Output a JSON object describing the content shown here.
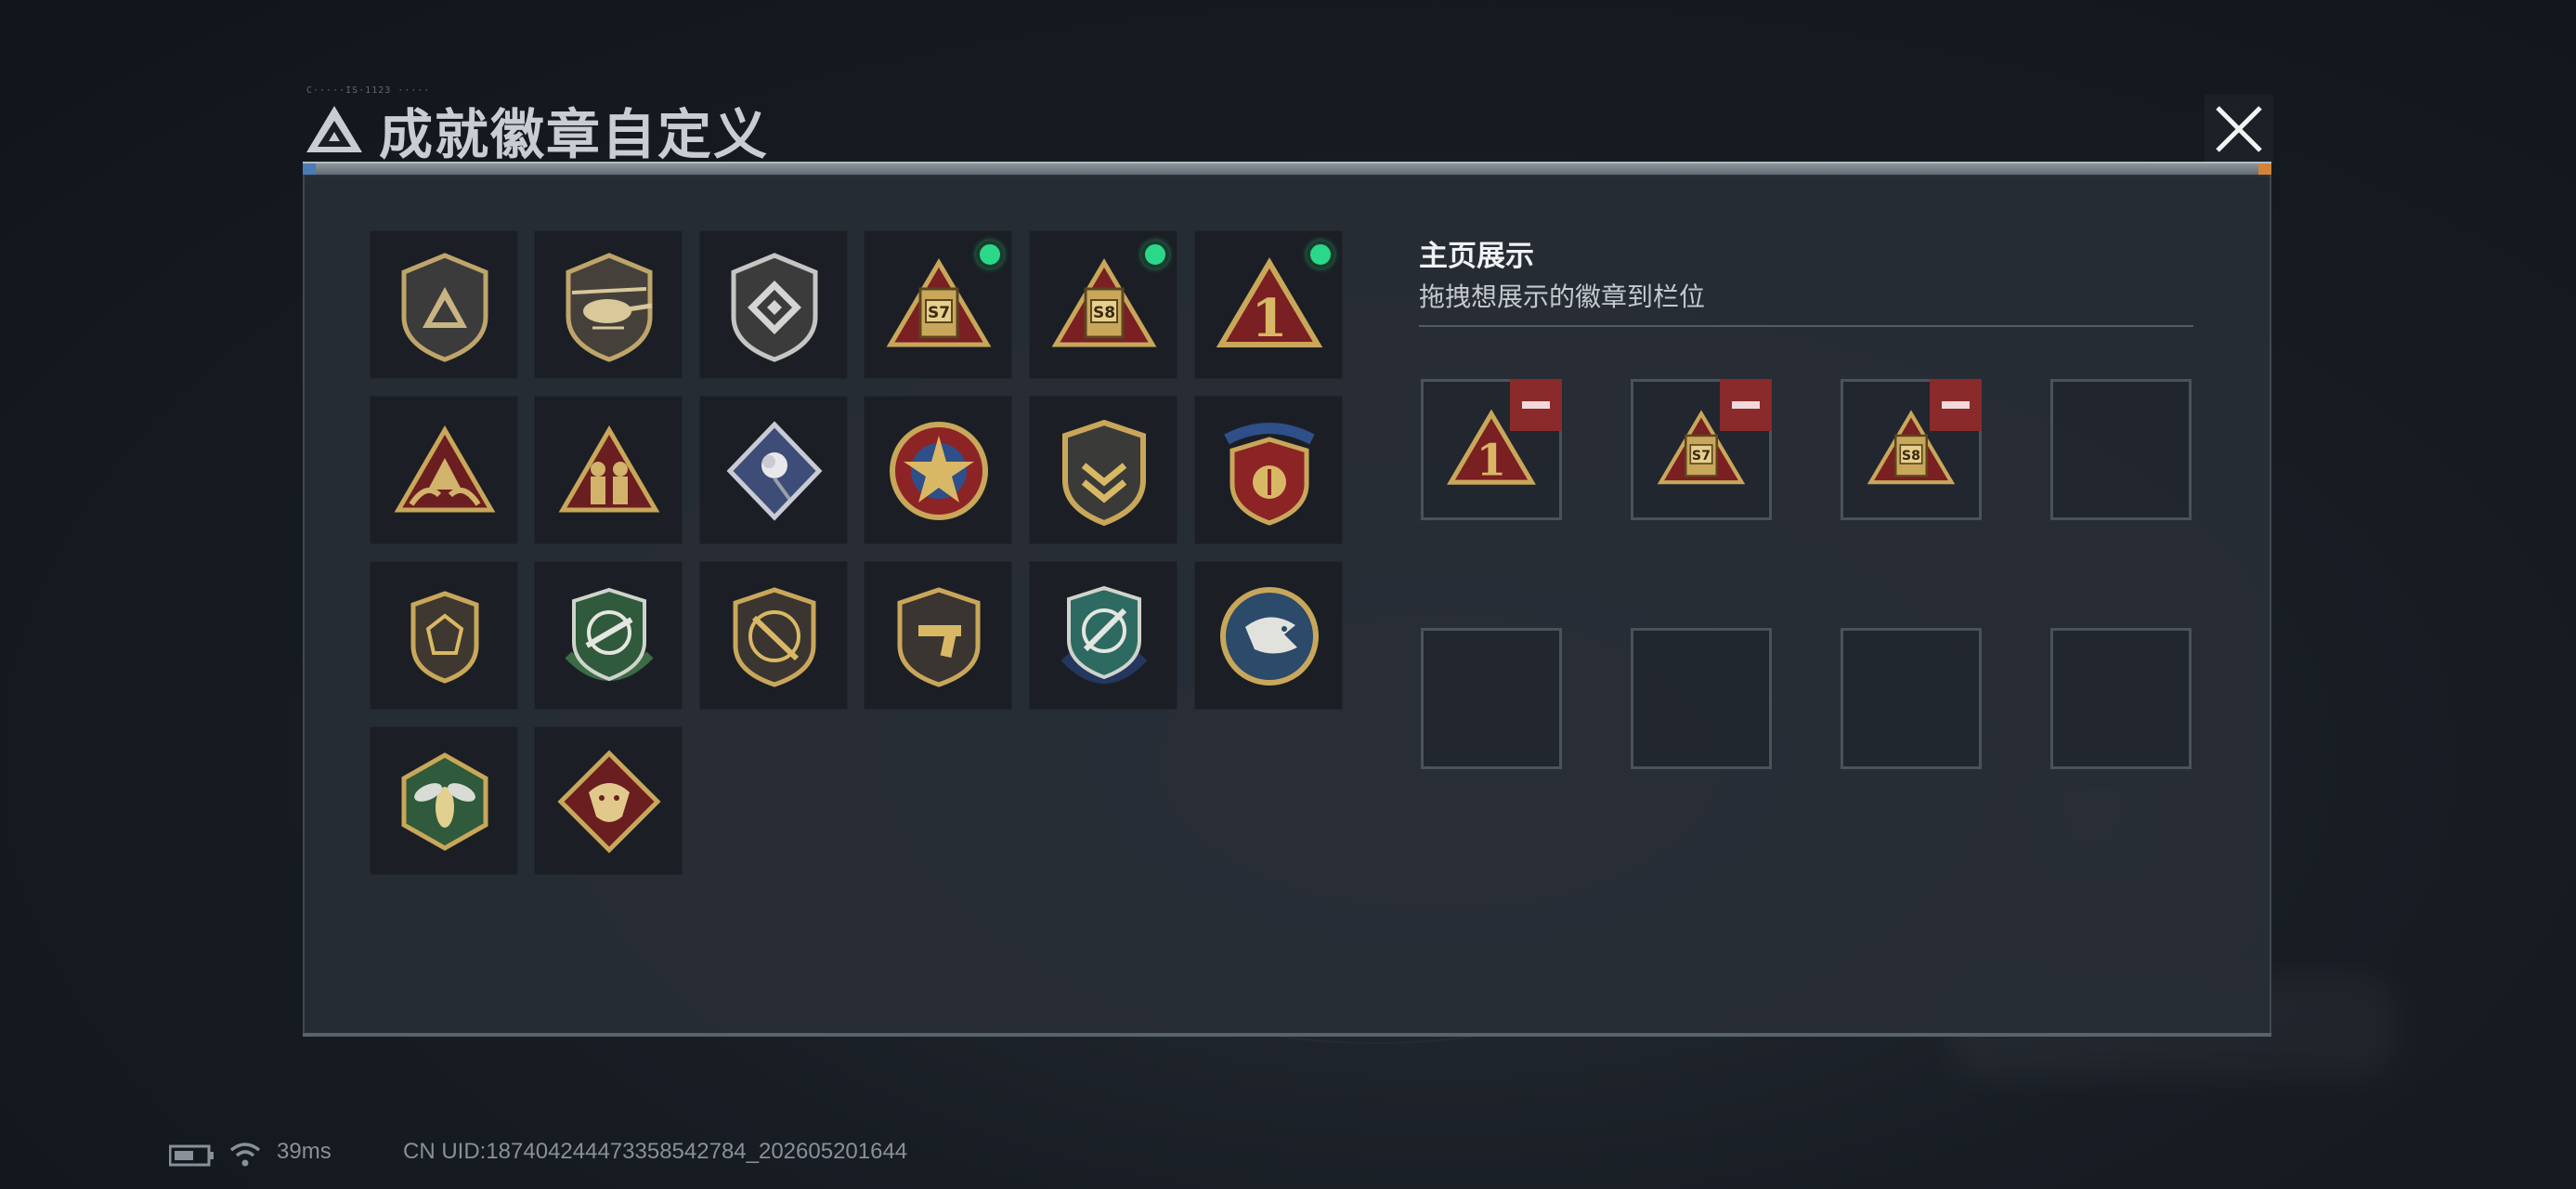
{
  "header": {
    "title": "成就徽章自定义",
    "deco_text": "C·····IS·1123 ·····"
  },
  "badges": [
    {
      "name": "triangle-logo-badge",
      "equipped": false
    },
    {
      "name": "helicopter-badge",
      "equipped": false
    },
    {
      "name": "diamond-emblem-badge",
      "equipped": false
    },
    {
      "name": "season-s7-badge",
      "text": "S7",
      "equipped": true
    },
    {
      "name": "season-s8-badge",
      "text": "S8",
      "equipped": true
    },
    {
      "name": "rank-one-badge",
      "text": "1",
      "equipped": true
    },
    {
      "name": "hands-triangle-badge",
      "equipped": false
    },
    {
      "name": "soldiers-triangle-badge",
      "equipped": false
    },
    {
      "name": "rose-diamond-badge",
      "equipped": false
    },
    {
      "name": "star-medal-badge",
      "equipped": false
    },
    {
      "name": "chevron-shield-badge",
      "equipped": false
    },
    {
      "name": "stars-shield-badge",
      "equipped": false
    },
    {
      "name": "gem-shield-badge",
      "equipped": false
    },
    {
      "name": "rifle-crosshair-badge",
      "equipped": false
    },
    {
      "name": "sniper-shield-badge",
      "equipped": false
    },
    {
      "name": "pistol-shield-badge",
      "equipped": false
    },
    {
      "name": "knife-crosshair-badge",
      "equipped": false
    },
    {
      "name": "eagle-round-badge",
      "equipped": false
    },
    {
      "name": "hornet-hexagon-badge",
      "equipped": false
    },
    {
      "name": "dragon-diamond-badge",
      "equipped": false
    }
  ],
  "showcase": {
    "title": "主页展示",
    "subtitle": "拖拽想展示的徽章到栏位",
    "slots": [
      {
        "badge": "rank-one-badge",
        "text": "1"
      },
      {
        "badge": "season-s7-badge",
        "text": "S7"
      },
      {
        "badge": "season-s8-badge",
        "text": "S8"
      },
      {
        "badge": null
      },
      {
        "badge": null
      },
      {
        "badge": null
      },
      {
        "badge": null
      },
      {
        "badge": null
      }
    ]
  },
  "status_bar": {
    "ping": "39ms",
    "uid": "CN UID:187404244473358542784_202605201644"
  },
  "colors": {
    "equipped_dot": "#2bd88a",
    "remove_button": "#8a2a2a",
    "gold": "#c9a75a",
    "crimson": "#7a1f22"
  }
}
